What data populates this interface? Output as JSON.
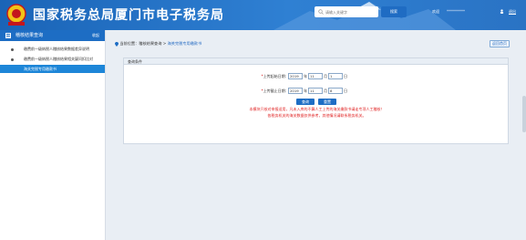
{
  "header": {
    "title": "国家税务总局厦门市电子税务局",
    "search_placeholder": "请输入关键字",
    "search_button": "搜索",
    "welcome": "欢迎",
    "user_name": "**********",
    "separator": "|",
    "logout": "退出"
  },
  "sidebar": {
    "title": "稽核结果查询",
    "close": "收起",
    "items": [
      {
        "label": "缴费前一级纳税人稽核结果数据差异说明"
      },
      {
        "label": "缴费前一级纳税人稽核结果相关疑问扣比对"
      },
      {
        "label": "海关完税专用缴款书"
      }
    ]
  },
  "breadcrumb": {
    "prefix": "当前位置：",
    "level1": "稽核结果查询",
    "sep": " > ",
    "current": "海关完税专用缴款书"
  },
  "back_button": "返回首页",
  "panel": {
    "title": "查询条件",
    "start_label": "上传起始日期:",
    "end_label": "上传截止日期:",
    "start_date": {
      "year": "2019",
      "month": "11",
      "day": "1"
    },
    "end_date": {
      "year": "2019",
      "month": "11",
      "day": "8"
    },
    "unit_year": "年",
    "unit_month": "月",
    "unit_day": "日",
    "required_mark": "*",
    "query_button": "查询",
    "reset_button": "重置",
    "note1": "本模块只核对申报适用，凡未入库的不算人工上传的海关缴款书请走专项人工稽核！",
    "note2": "各税务机关的海关数据仅供参考，其他情况请联系税务机关。"
  }
}
